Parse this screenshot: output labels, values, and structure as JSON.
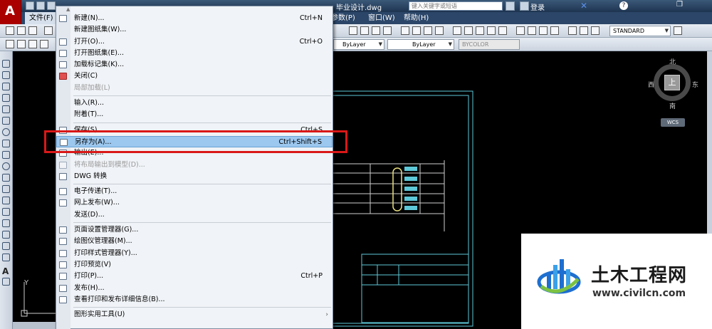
{
  "window": {
    "document_title": "毕业设计.dwg",
    "search_placeholder": "键入关键字或短语",
    "login_label": "登录",
    "help_label": "?"
  },
  "menubar": {
    "file": "文件(F)",
    "params": "参数(P)",
    "window": "窗口(W)",
    "help": "帮助(H)"
  },
  "toolbar": {
    "linetype": "ByLayer",
    "lineweight": "ByLayer",
    "plotstyle": "BYCOLOR",
    "textstyle": "STANDARD"
  },
  "viewcube": {
    "north": "北",
    "south": "南",
    "east": "东",
    "west": "西",
    "top": "上",
    "wcs": "WCS"
  },
  "ucs": {
    "y": "Y"
  },
  "file_menu": {
    "items": [
      {
        "label": "新建(N)...",
        "shortcut": "Ctrl+N"
      },
      {
        "label": "新建图纸集(W)..."
      },
      {
        "label": "打开(O)...",
        "shortcut": "Ctrl+O"
      },
      {
        "label": "打开图纸集(E)..."
      },
      {
        "label": "加载标记集(K)..."
      },
      {
        "label": "关闭(C)"
      },
      {
        "label": "局部加载(L)",
        "disabled": true
      },
      {
        "label": "输入(R)..."
      },
      {
        "label": "附着(T)..."
      },
      {
        "label": "保存(S)",
        "shortcut": "Ctrl+S"
      },
      {
        "label": "另存为(A)...",
        "shortcut": "Ctrl+Shift+S",
        "highlighted": true
      },
      {
        "label": "输出(E)..."
      },
      {
        "label": "将布局输出到模型(D)...",
        "disabled": true
      },
      {
        "label": "DWG 转换"
      },
      {
        "label": "电子传递(T)..."
      },
      {
        "label": "网上发布(W)..."
      },
      {
        "label": "发送(D)..."
      },
      {
        "label": "页面设置管理器(G)..."
      },
      {
        "label": "绘图仪管理器(M)..."
      },
      {
        "label": "打印样式管理器(Y)..."
      },
      {
        "label": "打印预览(V)"
      },
      {
        "label": "打印(P)...",
        "shortcut": "Ctrl+P"
      },
      {
        "label": "发布(H)..."
      },
      {
        "label": "查看打印和发布详细信息(B)..."
      },
      {
        "label": "图形实用工具(U)",
        "submenu": true
      }
    ]
  },
  "watermark": {
    "title": "土木工程网",
    "url": "www.civilcn.com"
  },
  "colors": {
    "highlight": "#9cc7ee",
    "annotation_red": "#d91818",
    "drawing_lines": "#5ec8d8"
  }
}
